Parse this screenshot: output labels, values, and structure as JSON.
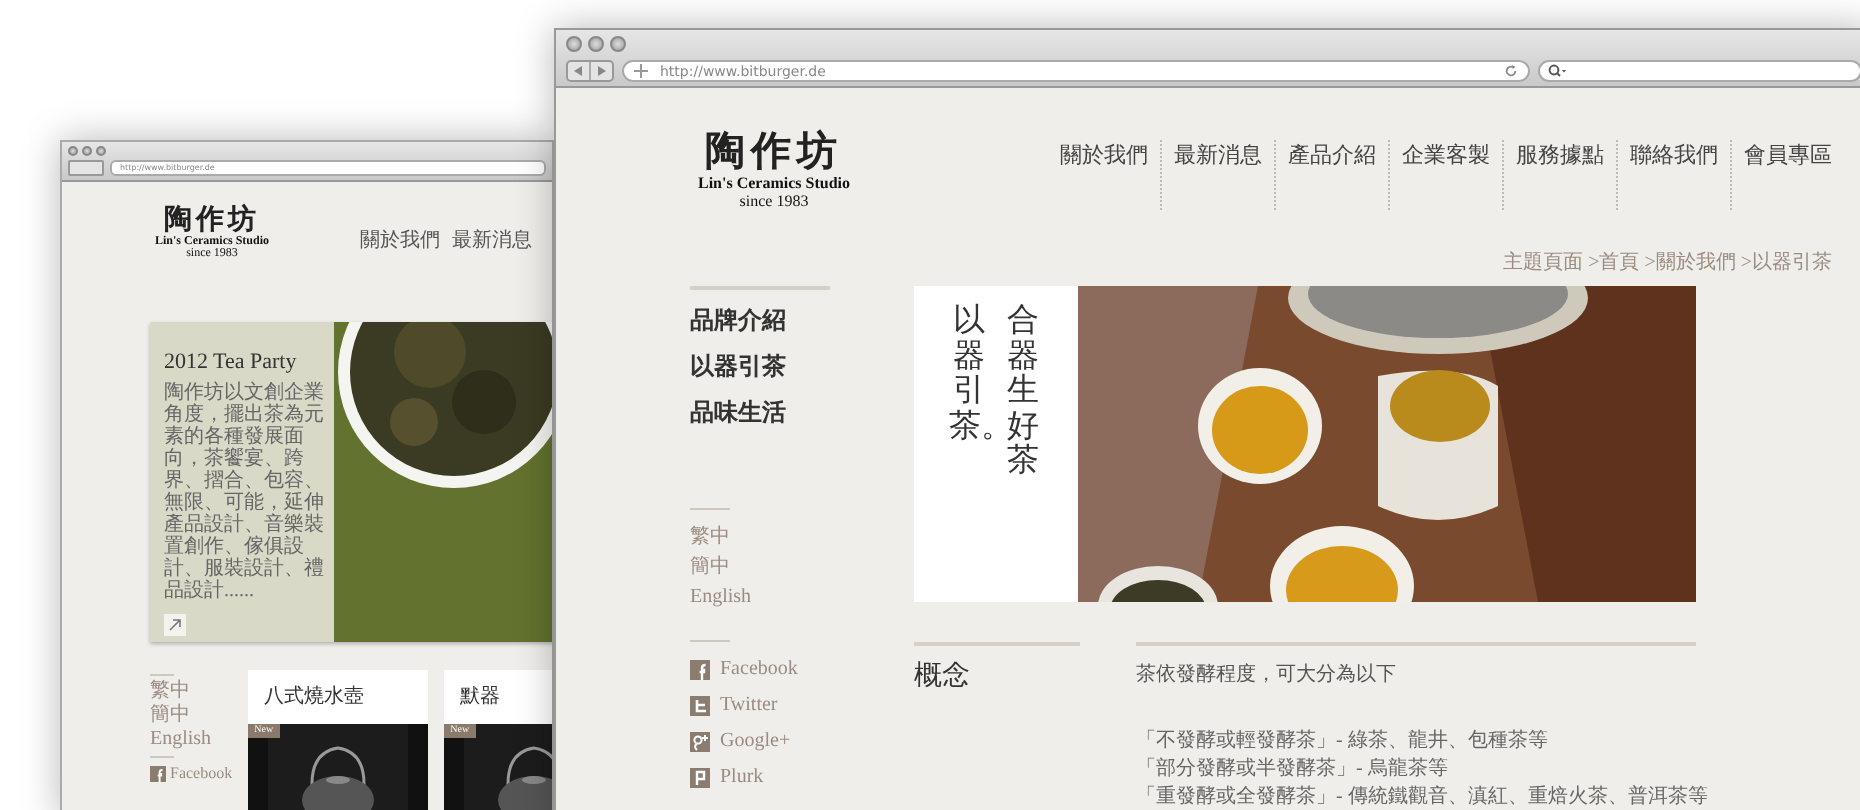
{
  "back_window": {
    "address": "http://www.bitburger.de",
    "logo": {
      "mark": "陶作坊",
      "name": "Lin's Ceramics Studio",
      "since": "since 1983"
    },
    "nav": [
      "關於我們",
      "最新消息"
    ],
    "feature": {
      "title": "2012 Tea Party",
      "text": "陶作坊以文創企業角度，擺出茶為元素的各種發展面向，茶饗宴、跨界、摺合、包容、無限、可能，延伸產品設計、音樂裝置創作、傢俱設計、服裝設計、禮品設計......"
    },
    "languages": [
      "繁中",
      "簡中",
      "English"
    ],
    "social": [
      {
        "kind": "facebook",
        "label": "Facebook"
      }
    ],
    "cards": [
      {
        "title": "八式燒水壺",
        "badge": "New"
      },
      {
        "title": "默器",
        "badge": "New"
      }
    ]
  },
  "front_window": {
    "address": "http://www.bitburger.de",
    "logo": {
      "mark": "陶作坊",
      "name": "Lin's Ceramics Studio",
      "since": "since 1983"
    },
    "nav": [
      "關於我們",
      "最新消息",
      "產品介紹",
      "企業客製",
      "服務據點",
      "聯絡我們",
      "會員專區"
    ],
    "breadcrumb": "主題頁面 >首頁 >關於我們 >以器引茶",
    "sidebar": [
      "品牌介紹",
      "以器引茶",
      "品味生活"
    ],
    "languages": [
      "繁中",
      "簡中",
      "English"
    ],
    "social": [
      {
        "kind": "facebook",
        "label": "Facebook"
      },
      {
        "kind": "twitter",
        "label": "Twitter"
      },
      {
        "kind": "googleplus",
        "label": "Google+"
      },
      {
        "kind": "plurk",
        "label": "Plurk"
      }
    ],
    "hero": {
      "lines": [
        "以器引茶。",
        "合器生好茶"
      ]
    },
    "concept": {
      "heading": "概念",
      "intro": "茶依發酵程度，可大分為以下",
      "items": [
        "「不發酵或輕發酵茶」- 綠茶、龍井、包種茶等",
        "「部分發酵或半發酵茶」- 烏龍茶等",
        "「重發酵或全發酵茶」- 傳統鐵觀音、滇紅、重焙火茶、普洱茶等"
      ]
    }
  }
}
